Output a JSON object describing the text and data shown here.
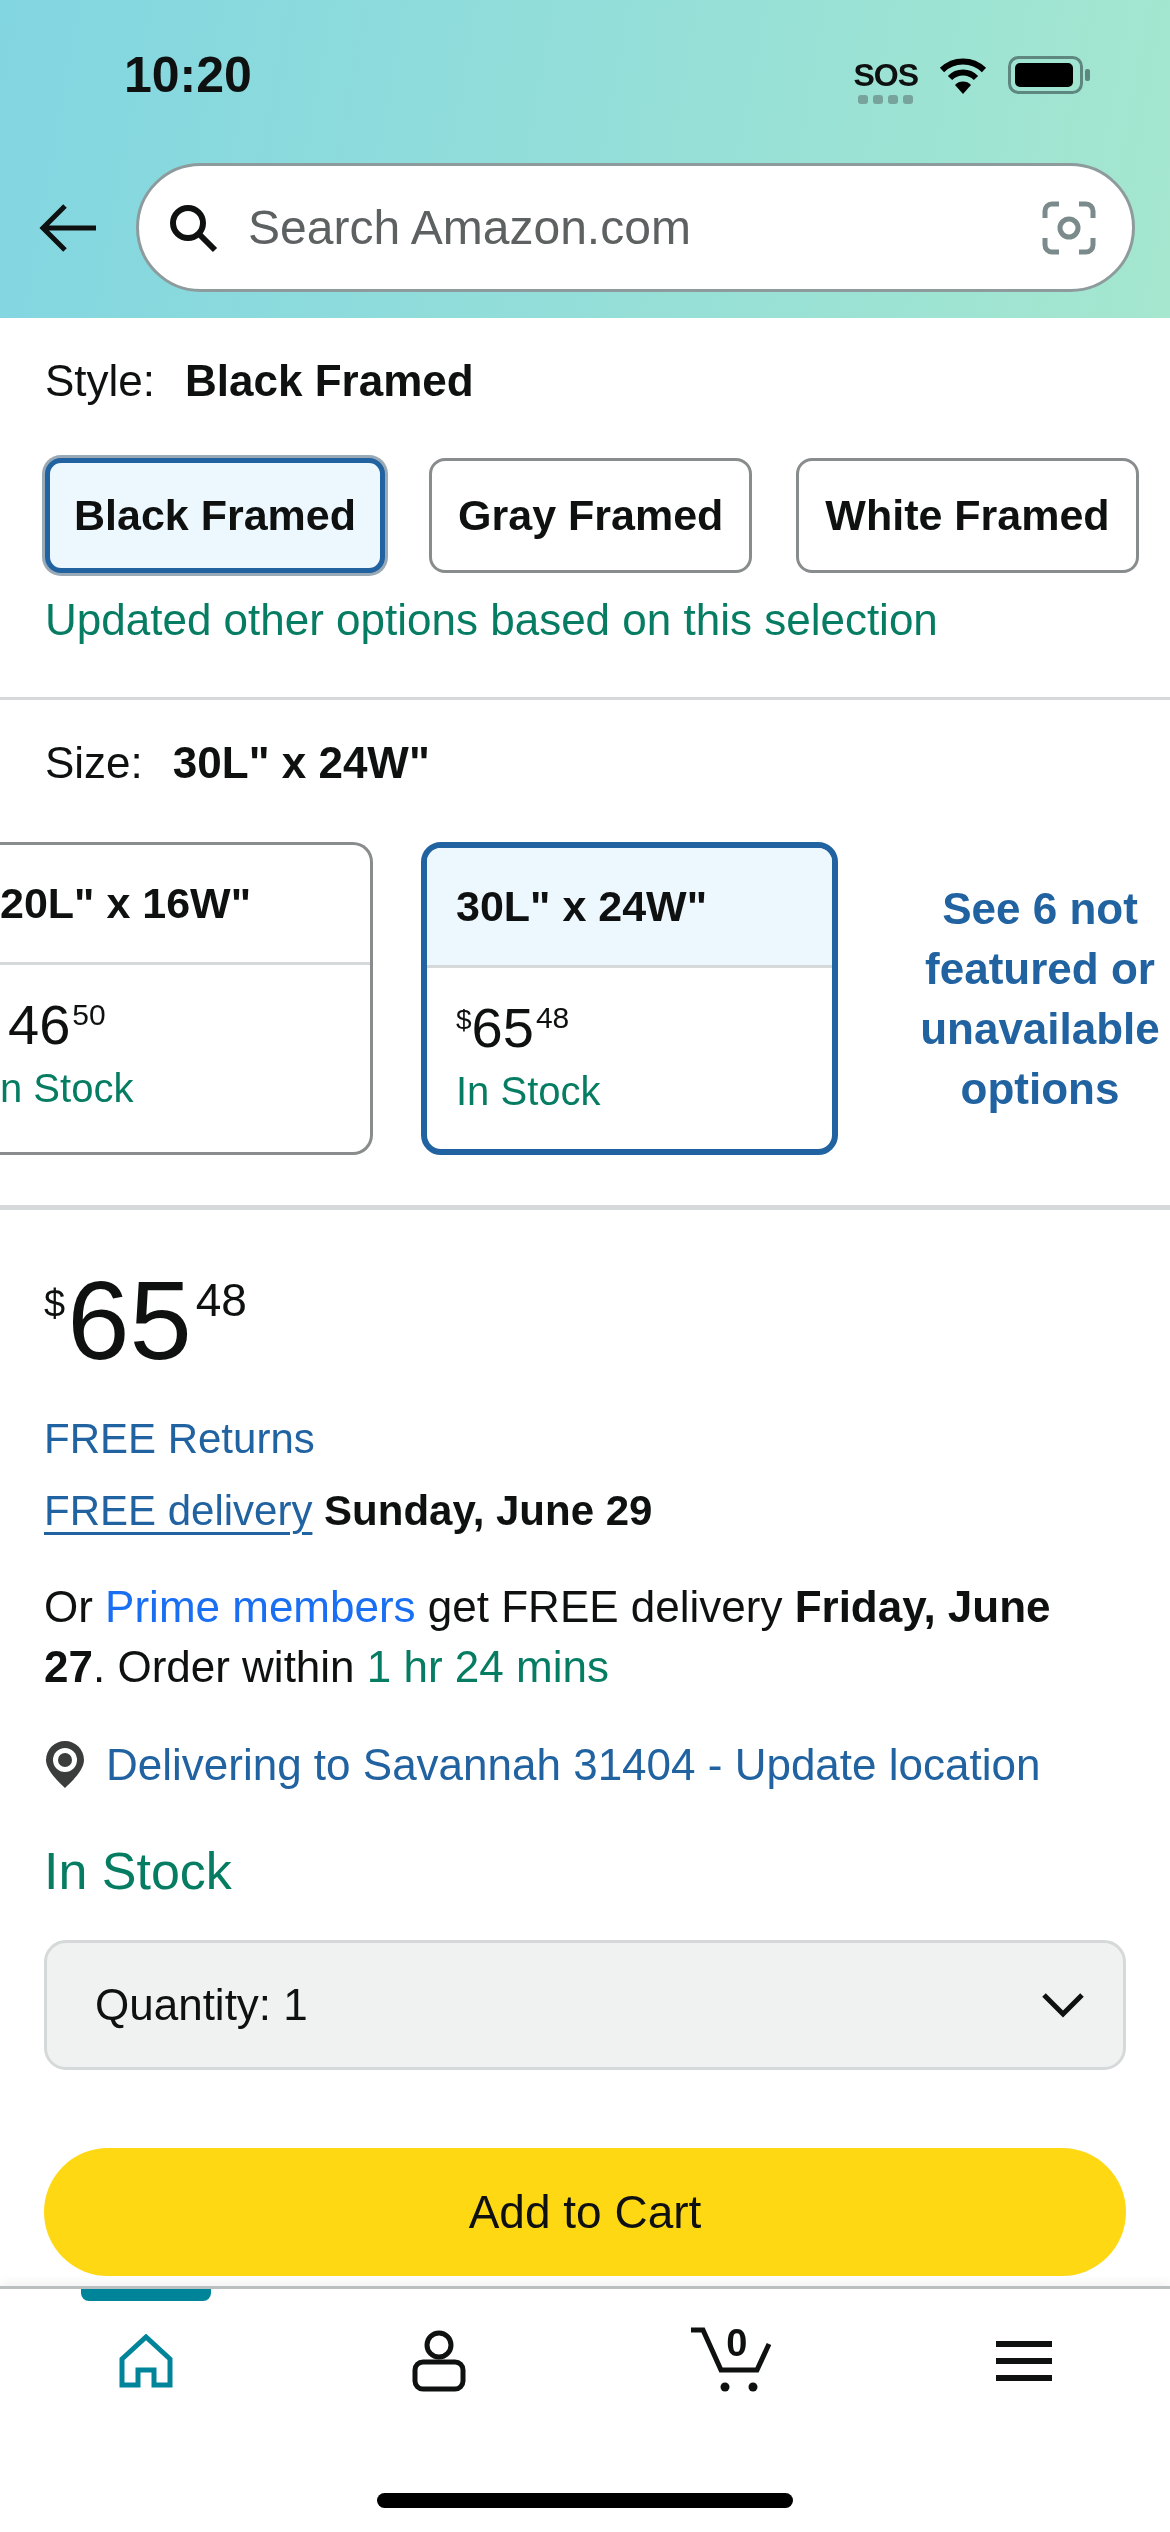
{
  "status_bar": {
    "time": "10:20",
    "cellular_status": "SOS"
  },
  "search": {
    "placeholder": "Search Amazon.com"
  },
  "style": {
    "label": "Style:",
    "value": "Black Framed",
    "options": [
      {
        "label": "Black Framed",
        "selected": true
      },
      {
        "label": "Gray Framed",
        "selected": false
      },
      {
        "label": "White Framed",
        "selected": false
      }
    ],
    "note": "Updated other options based on this selection"
  },
  "size": {
    "label": "Size:",
    "value": "30L\" x 24W\"",
    "options": [
      {
        "label": "20L\" x 16W\"",
        "price_whole": "46",
        "price_fraction": "50",
        "availability": "n Stock",
        "selected": false
      },
      {
        "label": "30L\" x 24W\"",
        "currency": "$",
        "price_whole": "65",
        "price_fraction": "48",
        "availability": "In Stock",
        "selected": true
      }
    ],
    "more_link": "See 6 not featured or unavailable options"
  },
  "price": {
    "currency": "$",
    "whole": "65",
    "fraction": "48"
  },
  "returns_link": "FREE Returns",
  "delivery": {
    "link": "FREE delivery",
    "date": "Sunday, June 29"
  },
  "prime_offer": [
    {
      "kind": "text",
      "text": "Or "
    },
    {
      "kind": "link",
      "text": "Prime members"
    },
    {
      "kind": "text",
      "text": " get FREE delivery **Friday, June 27**. Order within "
    },
    {
      "kind": "countdown",
      "text": "1 hr 24 mins"
    }
  ],
  "location_link": "Delivering to Savannah 31404 - Update location",
  "availability": "In Stock",
  "quantity": {
    "label": "Quantity:",
    "value": "1"
  },
  "add_to_cart": "Add to Cart",
  "nav": {
    "items": [
      {
        "kind": "home",
        "selected": true
      },
      {
        "kind": "account",
        "selected": false
      },
      {
        "kind": "cart",
        "selected": false,
        "badge": "0"
      },
      {
        "kind": "menu",
        "selected": false
      }
    ]
  }
}
